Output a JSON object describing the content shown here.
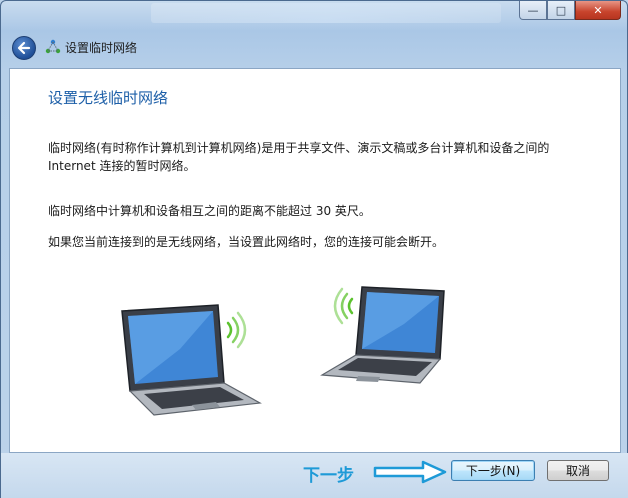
{
  "window": {
    "title": "设置临时网络",
    "caption": {
      "minimize": "—",
      "maximize": "□",
      "close": "✕"
    }
  },
  "content": {
    "heading": "设置无线临时网络",
    "paragraph1": "临时网络(有时称作计算机到计算机网络)是用于共享文件、演示文稿或多台计算机和设备之间的 Internet 连接的暂时网络。",
    "paragraph2": "临时网络中计算机和设备相互之间的距离不能超过 30 英尺。",
    "paragraph3": "如果您当前连接到的是无线网络，当设置此网络时，您的连接可能会断开。"
  },
  "annotation": {
    "label": "下一步"
  },
  "footer": {
    "next_label": "下一步(N)",
    "cancel_label": "取消"
  },
  "colors": {
    "heading": "#1d5fa8",
    "annotation": "#1e9ad7",
    "wifi": "#5cc22e"
  },
  "icons": [
    "back-arrow-icon",
    "network-icon",
    "laptop-icon",
    "wifi-signal-icon",
    "arrow-annotation-icon"
  ]
}
